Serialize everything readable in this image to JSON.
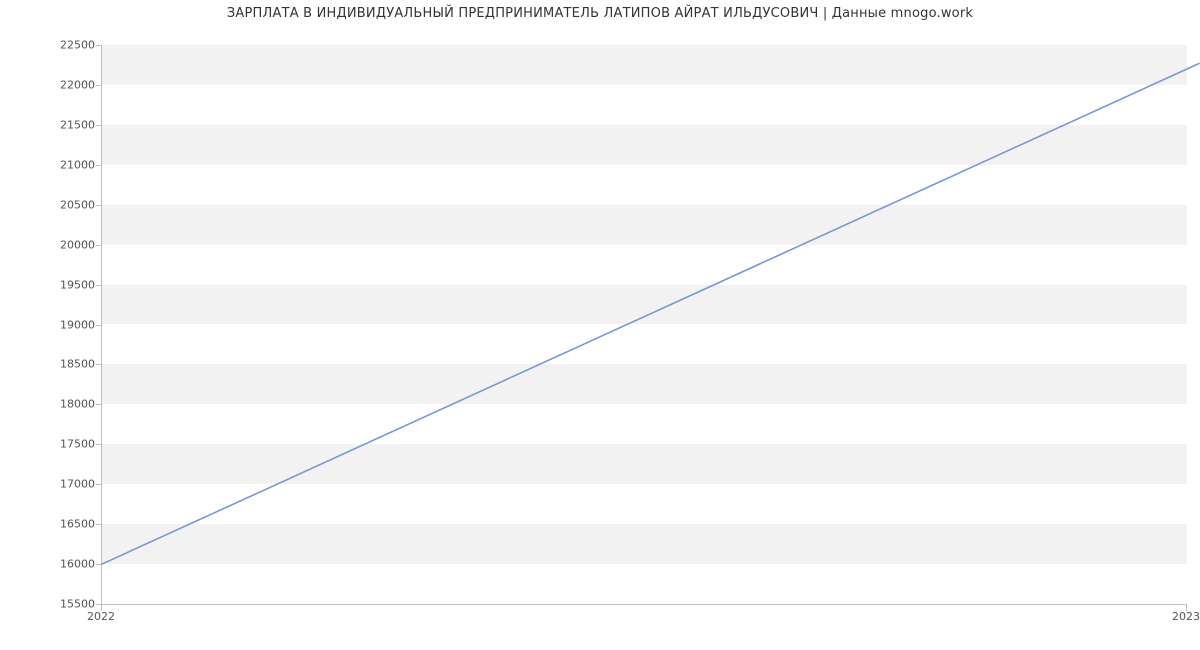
{
  "chart_data": {
    "type": "line",
    "title": "ЗАРПЛАТА В ИНДИВИДУАЛЬНЫЙ ПРЕДПРИНИМАТЕЛЬ ЛАТИПОВ АЙРАТ ИЛЬДУСОВИЧ | Данные mnogo.work",
    "xlabel": "",
    "ylabel": "",
    "x_ticks": [
      "2022",
      "2023"
    ],
    "y_ticks": [
      15500,
      16000,
      16500,
      17000,
      17500,
      18000,
      18500,
      19000,
      19500,
      20000,
      20500,
      21000,
      21500,
      22000,
      22500
    ],
    "ylim": [
      15500,
      22500
    ],
    "series": [
      {
        "name": "salary",
        "x": [
          "2022",
          "2023"
        ],
        "values": [
          16000,
          22200
        ]
      }
    ],
    "colors": {
      "line": "#7699d4",
      "band": "#f2f2f2",
      "axis": "#bfbfbf"
    }
  }
}
